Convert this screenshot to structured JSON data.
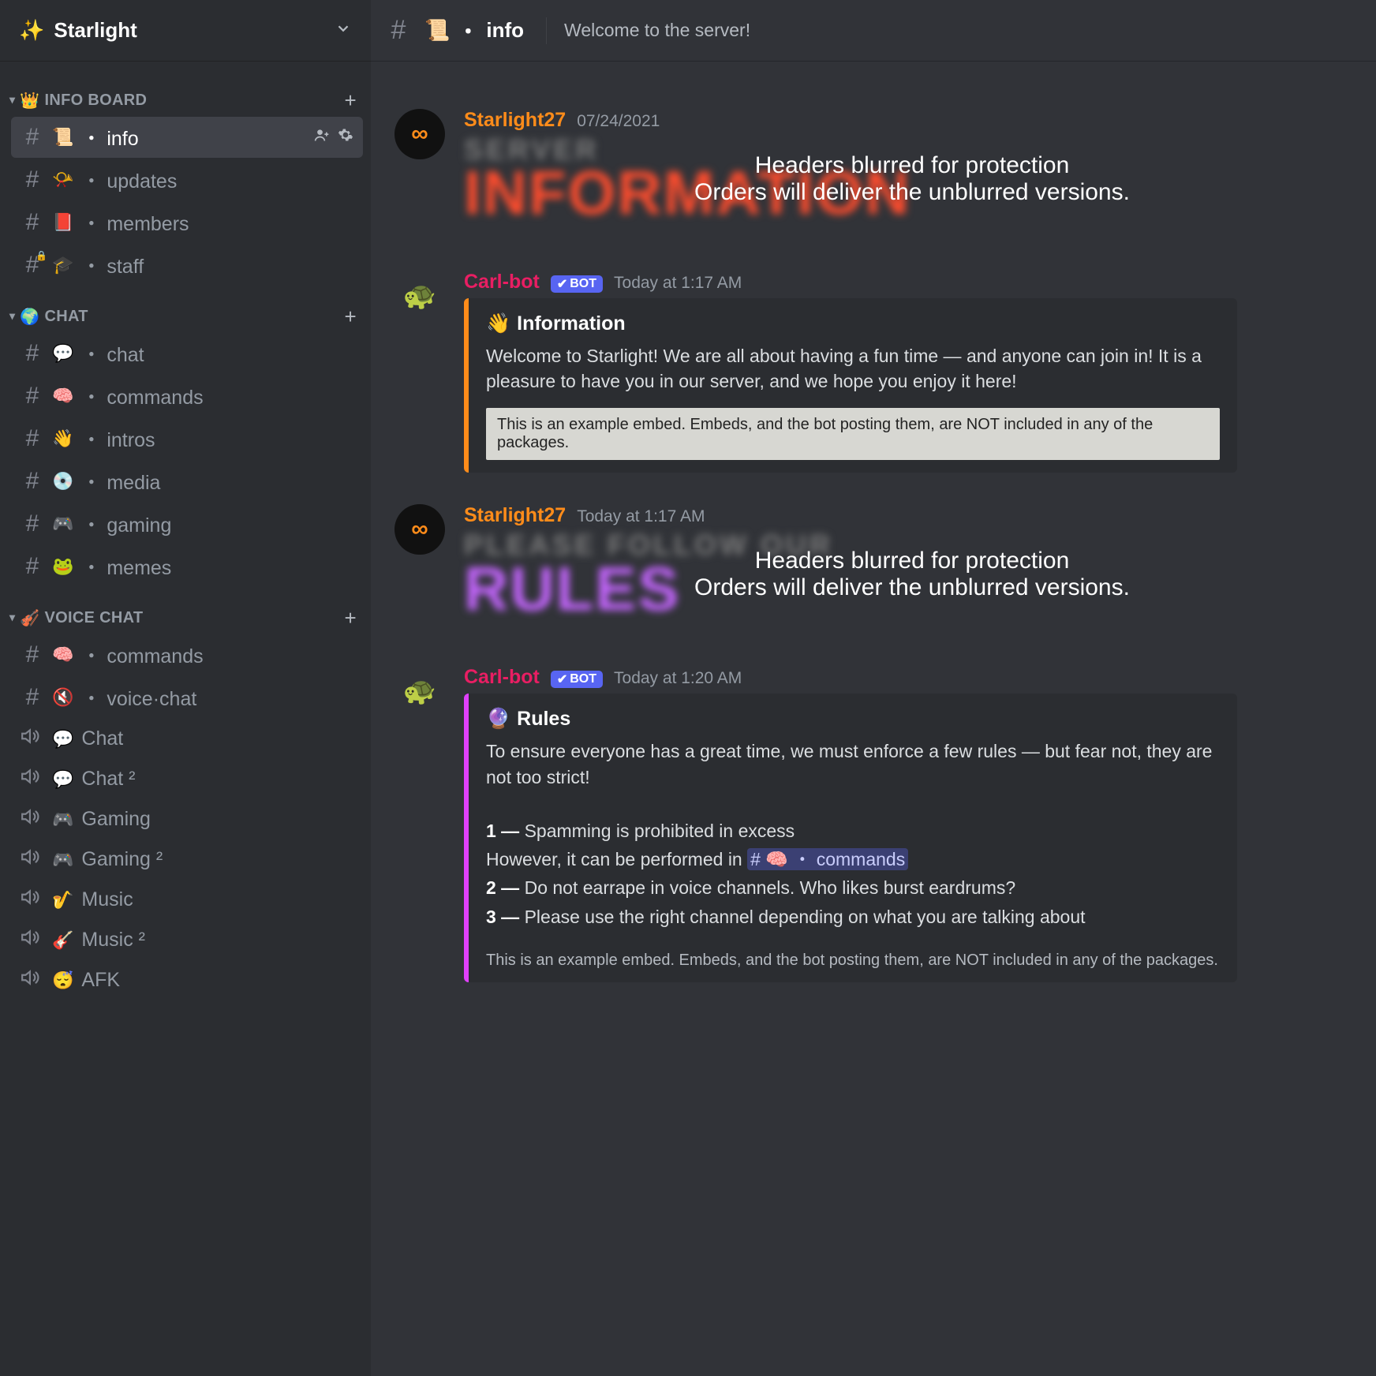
{
  "server": {
    "name": "Starlight",
    "icon": "✨"
  },
  "categories": [
    {
      "name": "INFO BOARD",
      "icon": "👑",
      "plus": true,
      "channels": [
        {
          "type": "text",
          "emoji": "📜",
          "name": "info",
          "active": true,
          "actions": true
        },
        {
          "type": "text",
          "emoji": "📯",
          "name": "updates"
        },
        {
          "type": "text",
          "emoji": "📕",
          "name": "members"
        },
        {
          "type": "text-locked",
          "emoji": "🎓",
          "name": "staff"
        }
      ]
    },
    {
      "name": "CHAT",
      "icon": "🌍",
      "plus": true,
      "channels": [
        {
          "type": "text",
          "emoji": "💬",
          "name": "chat"
        },
        {
          "type": "text",
          "emoji": "🧠",
          "name": "commands"
        },
        {
          "type": "text",
          "emoji": "👋",
          "name": "intros"
        },
        {
          "type": "text",
          "emoji": "💿",
          "name": "media"
        },
        {
          "type": "text",
          "emoji": "🎮",
          "name": "gaming"
        },
        {
          "type": "text",
          "emoji": "🐸",
          "name": "memes"
        }
      ]
    },
    {
      "name": "VOICE CHAT",
      "icon": "🎻",
      "plus": true,
      "channels": [
        {
          "type": "text",
          "emoji": "🧠",
          "name": "commands"
        },
        {
          "type": "text",
          "emoji": "🔇",
          "name": "voice·chat"
        },
        {
          "type": "voice",
          "emoji": "💬",
          "name": "Chat"
        },
        {
          "type": "voice",
          "emoji": "💬",
          "name": "Chat ²"
        },
        {
          "type": "voice",
          "emoji": "🎮",
          "name": "Gaming"
        },
        {
          "type": "voice",
          "emoji": "🎮",
          "name": "Gaming ²"
        },
        {
          "type": "voice",
          "emoji": "🎷",
          "name": "Music"
        },
        {
          "type": "voice",
          "emoji": "🎸",
          "name": "Music ²"
        },
        {
          "type": "voice",
          "emoji": "😴",
          "name": "AFK"
        }
      ]
    }
  ],
  "header": {
    "channel_emoji": "📜",
    "channel_name": "info",
    "topic": "Welcome to the server!"
  },
  "overlay": {
    "line1": "Headers blurred for protection",
    "line2": "Orders will deliver the unblurred versions."
  },
  "messages": [
    {
      "kind": "header",
      "author": "Starlight27",
      "author_color": "orange",
      "avatar": "infinity",
      "timestamp": "07/24/2021",
      "bg_line1": "SERVER",
      "bg_line2": "INFORMATION",
      "variant": "info"
    },
    {
      "kind": "embed",
      "author": "Carl-bot",
      "author_color": "pink",
      "avatar": "turtle",
      "bot": true,
      "timestamp": "Today at 1:17 AM",
      "embed_color": "orange",
      "title_emoji": "👋",
      "title": "Information",
      "desc": "Welcome to Starlight! We are all about having a fun time — and anyone can join in! It is a pleasure to have you in our server, and we hope you enjoy it here!",
      "note": "This is an example embed. Embeds, and the bot posting them, are NOT included in any of the packages.",
      "note_style": "box"
    },
    {
      "kind": "header",
      "author": "Starlight27",
      "author_color": "orange",
      "avatar": "infinity",
      "timestamp": "Today at 1:17 AM",
      "bg_line1": "PLEASE FOLLOW OUR",
      "bg_line2": "RULES",
      "variant": "rules"
    },
    {
      "kind": "rules-embed",
      "author": "Carl-bot",
      "author_color": "pink",
      "avatar": "turtle",
      "bot": true,
      "timestamp": "Today at 1:20 AM",
      "embed_color": "purple",
      "title_emoji": "🔮",
      "title": "Rules",
      "intro": "To ensure everyone has a great time, we must enforce a few rules — but fear not, they are not too strict!",
      "rules": [
        {
          "n": "1",
          "text": "Spamming is prohibited in excess"
        },
        {
          "sub": "However, it can be performed in ",
          "mention": "# 🧠 ・ commands"
        },
        {
          "n": "2",
          "text": "Do not earrape in voice channels. Who likes burst eardrums?"
        },
        {
          "n": "3",
          "text": "Please use the right channel depending on what you are talking about"
        }
      ],
      "note": "This is an example embed. Embeds, and the bot posting them, are NOT included in any of the packages.",
      "note_style": "transparent"
    }
  ],
  "bot_tag": {
    "check": "✔",
    "label": "BOT"
  }
}
